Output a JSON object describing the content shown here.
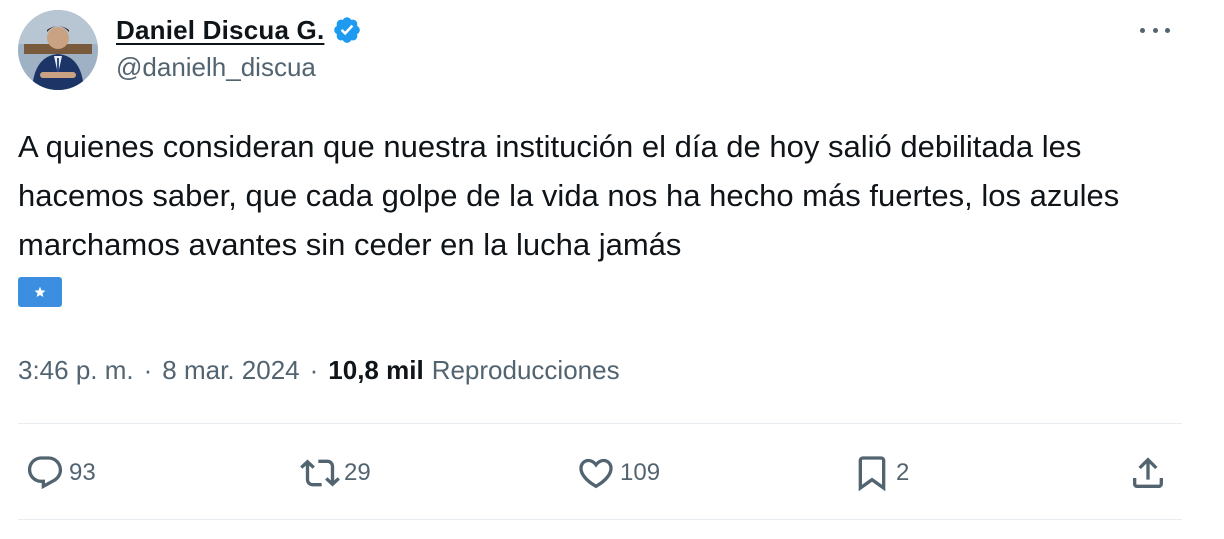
{
  "author": {
    "display_name": "Daniel Discua G.",
    "handle": "@danielh_discua",
    "verified": true
  },
  "tweet": {
    "text": "A quienes consideran que nuestra institución el día de hoy salió debilitada les hacemos saber, que cada golpe de la vida nos ha hecho más fuertes, los azules marchamos avantes sin ceder en la lucha jamás",
    "emoji": "flag-honduras",
    "time": "3:46 p. m.",
    "separator": "·",
    "date": "8 mar. 2024",
    "views_count": "10,8 mil",
    "views_label": "Reproducciones"
  },
  "actions": {
    "replies": "93",
    "retweets": "29",
    "likes": "109",
    "bookmarks": "2"
  },
  "icons": {
    "more": "more-dots-icon",
    "reply": "reply-bubble-icon",
    "retweet": "retweet-icon",
    "like": "heart-icon",
    "bookmark": "bookmark-icon",
    "share": "share-upload-icon"
  },
  "colors": {
    "verified_blue": "#1d9bf0",
    "text_primary": "#0f1419",
    "text_secondary": "#536471",
    "flag_blue": "#3c8ee0"
  }
}
